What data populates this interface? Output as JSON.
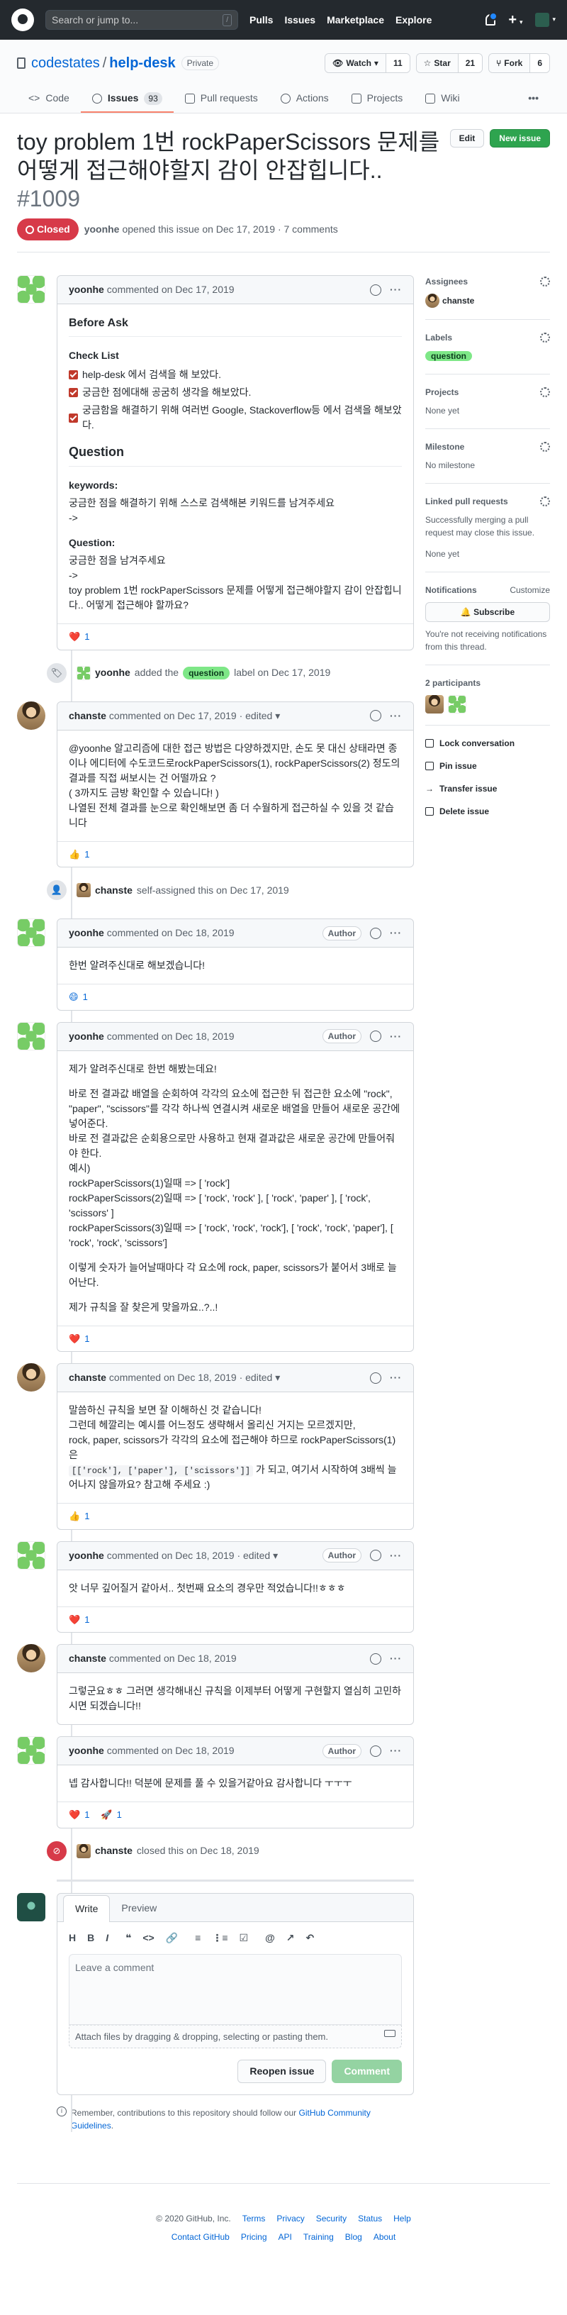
{
  "header": {
    "search_placeholder": "Search or jump to...",
    "slash_key": "/",
    "nav": [
      "Pulls",
      "Issues",
      "Marketplace",
      "Explore"
    ]
  },
  "repo": {
    "owner": "codestates",
    "name": "help-desk",
    "visibility": "Private",
    "watch_label": "Watch",
    "watch_count": "11",
    "star_label": "Star",
    "star_count": "21",
    "fork_label": "Fork",
    "fork_count": "6"
  },
  "tabs": [
    {
      "label": "Code",
      "icon": "code-icon"
    },
    {
      "label": "Issues",
      "icon": "issue-icon",
      "count": "93"
    },
    {
      "label": "Pull requests",
      "icon": "pr-icon"
    },
    {
      "label": "Actions",
      "icon": "play-icon"
    },
    {
      "label": "Projects",
      "icon": "project-icon"
    },
    {
      "label": "Wiki",
      "icon": "book-icon"
    },
    {
      "label": "•••",
      "icon": "more-icon"
    }
  ],
  "issue": {
    "title": "toy problem 1번 rockPaperScissors 문제를 어떻게 접근해야할지 감이 안잡힙니다..",
    "number": "#1009",
    "status": "Closed",
    "opener": "yoonhe",
    "opened_text": "opened this issue on Dec 17, 2019 · 7 comments",
    "edit_label": "Edit",
    "new_issue_label": "New issue"
  },
  "comments": [
    {
      "author": "yoonhe",
      "meta": "commented on Dec 17, 2019",
      "before_ask": "Before Ask",
      "checklist_title": "Check List",
      "checklist": [
        "help-desk 에서 검색을 해 보았다.",
        "궁금한 점에대해 공굼히 생각을 해보았다.",
        "궁금함을 해결하기 위해 여러번 Google, Stackoverflow등 에서 검색을 해보았다."
      ],
      "question_title": "Question",
      "keywords_title": "keywords:",
      "keywords_text": "궁금한 점을 해결하기 위해 스스로 검색해본 키워드를 남겨주세요",
      "keywords_arrow": "->",
      "question_sub": "Question:",
      "question_hint": "궁금한 점을 남겨주세요",
      "question_arrow": "->",
      "question_text": "toy problem 1번 rockPaperScissors 문제를 어떻게 접근해야할지 감이 안잡힙니다.. 어떻게 접근해야 할까요?",
      "reaction_emoji": "❤️",
      "reaction_count": "1"
    },
    {
      "author": "chanste",
      "meta": "commented on Dec 17, 2019 · edited",
      "body": [
        "@yoonhe 알고리즘에 대한 접근 방법은 다양하겠지만, 손도 못 대신 상태라면 종이나 에디터에 수도코드로rockPaperScissors(1), rockPaperScissors(2) 정도의 결과를 직접 써보시는 건 어떨까요 ?",
        "( 3까지도 금방 확인할 수 있습니다! )",
        "나열된 전체 결과를 눈으로 확인해보면 좀 더 수월하게 접근하실 수 있을 것 같습니다"
      ],
      "reaction_emoji": "👍",
      "reaction_count": "1"
    },
    {
      "author": "yoonhe",
      "meta": "commented on Dec 18, 2019",
      "badge": "Author",
      "body": [
        "한번 알려주신대로 해보겠습니다!"
      ],
      "reaction_emoji": "😄",
      "reaction_count": "1"
    },
    {
      "author": "yoonhe",
      "meta": "commented on Dec 18, 2019",
      "badge": "Author",
      "body": [
        "제가 알려주신대로 한번 해봤는데요!",
        "바로 전 결과값 배열을 순회하여 각각의 요소에 접근한 뒤 접근한 요소에 \"rock\", \"paper\", \"scissors\"를 각각 하나씩 연결시켜 새로운 배열을 만들어 새로운 공간에 넣어준다.",
        "바로 전 결과값은 순회용으로만 사용하고 현재 결과값은 새로운 공간에 만들어줘야 한다.",
        "예시)",
        "rockPaperScissors(1)일때 => [ 'rock']",
        "rockPaperScissors(2)일때 => [ 'rock', 'rock' ], [ 'rock', 'paper' ], [ 'rock', 'scissors' ]",
        "rockPaperScissors(3)일때 => [ 'rock', 'rock', 'rock'], [ 'rock', 'rock', 'paper'], [ 'rock', 'rock', 'scissors']",
        "이렇게 숫자가 늘어날때마다 각 요소에 rock, paper, scissors가 붙어서 3배로 늘어난다.",
        "제가 규칙을 잘 찾은게 맞을까요..?..!"
      ],
      "reaction_emoji": "❤️",
      "reaction_count": "1"
    },
    {
      "author": "chanste",
      "meta": "commented on Dec 18, 2019 · edited",
      "body_lines": [
        "말씀하신 규칙을 보면 잘 이해하신 것 같습니다!",
        "그런데 헤깔리는 예시를 어느정도 생략해서 올리신 거지는 모르겠지만,",
        "rock, paper, scissors가 각각의 요소에 접근해야 하므로 rockPaperScissors(1)은"
      ],
      "code": "[['rock'], ['paper'], ['scissors']]",
      "code_after": " 가 되고, 여기서 시작하여 3배씩 늘어나지 않을까요? 참고해 주세요 :)",
      "reaction_emoji": "👍",
      "reaction_count": "1"
    },
    {
      "author": "yoonhe",
      "meta": "commented on Dec 18, 2019 · edited",
      "badge": "Author",
      "body": [
        "앗 너무 깊어질거 같아서.. 첫번째 요소의 경우만 적었습니다!!ㅎㅎㅎ"
      ],
      "reaction_emoji": "❤️",
      "reaction_count": "1"
    },
    {
      "author": "chanste",
      "meta": "commented on Dec 18, 2019",
      "body": [
        "그렇군요ㅎㅎ 그러면 생각해내신 규칙을 이제부터 어떻게 구현할지 열심히 고민하시면 되겠습니다!!"
      ]
    },
    {
      "author": "yoonhe",
      "meta": "commented on Dec 18, 2019",
      "badge": "Author",
      "body": [
        "넵 감사합니다!! 덕분에 문제를 풀 수 있을거같아요 감사합니다 ㅜㅜㅜ"
      ],
      "reaction_emoji": "❤️",
      "reaction_count": "1",
      "reaction2_emoji": "🚀",
      "reaction2_count": "1"
    }
  ],
  "events": {
    "label_event": {
      "actor": "yoonhe",
      "before": "added the",
      "label": "question",
      "after": "label on Dec 17, 2019"
    },
    "assign_event": {
      "actor": "chanste",
      "text": "self-assigned this on Dec 17, 2019"
    },
    "close_event": {
      "actor": "chanste",
      "text": "closed this on Dec 18, 2019"
    }
  },
  "editor": {
    "tab_write": "Write",
    "tab_preview": "Preview",
    "toolbar": [
      "H",
      "B",
      "I",
      "❝",
      "<>",
      "🔗",
      "≡",
      "⋮≡",
      "☑",
      "@",
      "↗",
      "↶"
    ],
    "placeholder": "Leave a comment",
    "attach_text": "Attach files by dragging & dropping, selecting or pasting them.",
    "reopen_label": "Reopen issue",
    "comment_label": "Comment",
    "notice_prefix": "Remember, contributions to this repository should follow our",
    "notice_link": "GitHub Community Guidelines",
    "notice_suffix": "."
  },
  "sidebar": {
    "assignees_title": "Assignees",
    "assignee": "chanste",
    "labels_title": "Labels",
    "label": "question",
    "projects_title": "Projects",
    "projects_value": "None yet",
    "milestone_title": "Milestone",
    "milestone_value": "No milestone",
    "linked_title": "Linked pull requests",
    "linked_desc": "Successfully merging a pull request may close this issue.",
    "linked_value": "None yet",
    "notifications_title": "Notifications",
    "customize_label": "Customize",
    "subscribe_label": "Subscribe",
    "notif_desc": "You're not receiving notifications from this thread.",
    "participants_title": "2 participants",
    "actions": [
      "Lock conversation",
      "Pin issue",
      "Transfer issue",
      "Delete issue"
    ]
  },
  "footer": {
    "copyright": "© 2020 GitHub, Inc.",
    "row1": [
      "Terms",
      "Privacy",
      "Security",
      "Status",
      "Help"
    ],
    "row2": [
      "Contact GitHub",
      "Pricing",
      "API",
      "Training",
      "Blog",
      "About"
    ]
  },
  "colors": {
    "accent": "#0366d6",
    "closed": "#d73a49",
    "label_question": "#7ee787",
    "tab_underline": "#f9826c"
  }
}
